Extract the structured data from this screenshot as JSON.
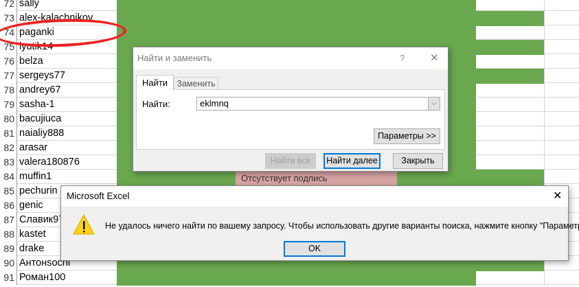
{
  "rows": [
    {
      "n": "72",
      "v": "sally",
      "c": false
    },
    {
      "n": "73",
      "v": "alex-kalachnikov",
      "c": true
    },
    {
      "n": "74",
      "v": "paganki",
      "c": false
    },
    {
      "n": "75",
      "v": "lyutik14",
      "c": true
    },
    {
      "n": "76",
      "v": "belza",
      "c": false
    },
    {
      "n": "77",
      "v": "sergeys77",
      "c": true
    },
    {
      "n": "78",
      "v": "andrey67",
      "c": false
    },
    {
      "n": "79",
      "v": "sasha-1",
      "c": false
    },
    {
      "n": "80",
      "v": "bacujiuca",
      "c": false
    },
    {
      "n": "81",
      "v": "naialiy888",
      "c": false
    },
    {
      "n": "82",
      "v": "arasar",
      "c": false
    },
    {
      "n": "83",
      "v": "valera180876",
      "c": false
    },
    {
      "n": "84",
      "v": "muffin1",
      "c": true
    },
    {
      "n": "85",
      "v": "pechurin",
      "c": true
    },
    {
      "n": "86",
      "v": "genic",
      "c": true
    },
    {
      "n": "87",
      "v": "Славик97",
      "c": true
    },
    {
      "n": "88",
      "v": "kastet",
      "c": true
    },
    {
      "n": "89",
      "v": "drake",
      "c": true
    },
    {
      "n": "90",
      "v": "Антонsochi",
      "c": true
    },
    {
      "n": "91",
      "v": "Роман100",
      "c": false
    }
  ],
  "pink_cell": "Отсутствует подпись",
  "find": {
    "title": "Найти и заменить",
    "help": "?",
    "close": "✕",
    "tab_find": "Найти",
    "tab_replace": "Заменить",
    "label": "Найти:",
    "value": "eklmnq",
    "params": "Параметры >>",
    "find_all": "Найти все",
    "find_next": "Найти далее",
    "close_btn": "Закрыть"
  },
  "msg": {
    "title": "Microsoft Excel",
    "close": "✕",
    "text": "Не удалось ничего найти по вашему запросу. Чтобы использовать другие варианты поиска, нажмите кнопку \"Параметры\".",
    "ok": "OK"
  },
  "colors": {
    "green": "#6aa84f",
    "accent": "#0078d7"
  }
}
